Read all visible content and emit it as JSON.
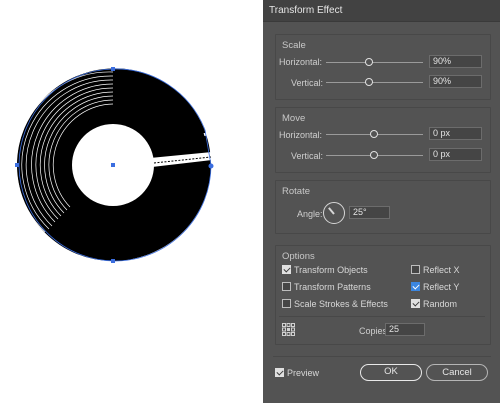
{
  "dialog": {
    "title": "Transform Effect",
    "scale": {
      "header": "Scale",
      "horizontal": {
        "label": "Horizontal:",
        "value": "90%"
      },
      "vertical": {
        "label": "Vertical:",
        "value": "90%"
      }
    },
    "move": {
      "header": "Move",
      "horizontal": {
        "label": "Horizontal:",
        "value": "0 px"
      },
      "vertical": {
        "label": "Vertical:",
        "value": "0 px"
      }
    },
    "rotate": {
      "header": "Rotate",
      "angle_label": "Angle:",
      "angle_value": "25°"
    },
    "options": {
      "header": "Options",
      "transform_objects": {
        "label": "Transform Objects",
        "checked": true
      },
      "transform_patterns": {
        "label": "Transform Patterns",
        "checked": false
      },
      "scale_strokes": {
        "label": "Scale Strokes & Effects",
        "checked": false
      },
      "reflect_x": {
        "label": "Reflect X",
        "checked": false
      },
      "reflect_y": {
        "label": "Reflect Y",
        "checked": true
      },
      "random": {
        "label": "Random",
        "checked": true
      },
      "copies_label": "Copies",
      "copies_value": "25"
    },
    "preview": {
      "label": "Preview",
      "checked": true
    },
    "ok_label": "OK",
    "cancel_label": "Cancel"
  },
  "colors": {
    "dialog_bg": "#535353",
    "title_bg": "#424242",
    "selection_blue": "#3b6ee0",
    "accent_checkbox": "#3b86e0"
  }
}
